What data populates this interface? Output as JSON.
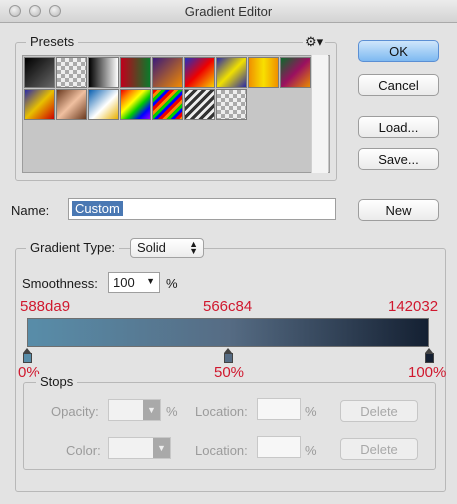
{
  "window": {
    "title": "Gradient Editor"
  },
  "presets": {
    "label": "Presets",
    "gear_icon": "gear-icon",
    "swatches": [
      {
        "bg": "linear-gradient(135deg,#000,#666)"
      },
      {
        "bg": "repeating-conic-gradient(#aaa 0% 25%, #eee 0% 50%) 0 0/8px 8px"
      },
      {
        "bg": "linear-gradient(90deg,#000,#fff)"
      },
      {
        "bg": "linear-gradient(90deg,#c0001b,#0a7a2a)"
      },
      {
        "bg": "linear-gradient(135deg,#3a1a7a,#f28a00)"
      },
      {
        "bg": "linear-gradient(135deg,#2030c0,#e00,#f7d000)"
      },
      {
        "bg": "linear-gradient(135deg,#2a2aa8,#f0e000,#2a2aa8)"
      },
      {
        "bg": "linear-gradient(90deg,#f09000,#f8e000,#f09000)"
      },
      {
        "bg": "linear-gradient(135deg,#0a6a2a,#9a1060,#e88a00)"
      },
      {
        "bg": "linear-gradient(135deg,#2a2aa8,#e8c000,#c00)"
      },
      {
        "bg": "linear-gradient(135deg,#6a3a20,#f0c0a0,#6a3a20)"
      },
      {
        "bg": "linear-gradient(135deg,#0a60b0,#ffffff 55%,#e8b000)"
      },
      {
        "bg": "linear-gradient(135deg,#e00,#f80,#ff0,#0c0,#00f,#90f)"
      },
      {
        "bg": "repeating-linear-gradient(135deg,#e00 0 3px,#f80 3px 6px,#0c0 6px 9px,#00f 9px 12px)"
      },
      {
        "bg": "repeating-linear-gradient(135deg,#333 0 3px,#eee 3px 6px)"
      },
      {
        "bg": "repeating-conic-gradient(#aaa 0% 25%, #eee 0% 50%) 0 0/8px 8px"
      }
    ]
  },
  "buttons": {
    "ok": "OK",
    "cancel": "Cancel",
    "load": "Load...",
    "save": "Save...",
    "new": "New"
  },
  "name": {
    "label": "Name:",
    "value": "Custom"
  },
  "gradient_type": {
    "label": "Gradient Type:",
    "value": "Solid",
    "smoothness_label": "Smoothness:",
    "smoothness_value": "100",
    "smoothness_unit": "%"
  },
  "gradient": {
    "colors": [
      "#588da9",
      "#566c84",
      "#142032"
    ],
    "labels": [
      "588da9",
      "566c84",
      "142032"
    ],
    "stop_positions": [
      0,
      50,
      100
    ],
    "percent_labels": [
      "0%",
      "50%",
      "100%"
    ]
  },
  "stops": {
    "label": "Stops",
    "opacity_label": "Opacity:",
    "opacity_unit": "%",
    "location_label_1": "Location:",
    "location_unit_1": "%",
    "delete_1": "Delete",
    "color_label": "Color:",
    "location_label_2": "Location:",
    "location_unit_2": "%",
    "delete_2": "Delete"
  }
}
